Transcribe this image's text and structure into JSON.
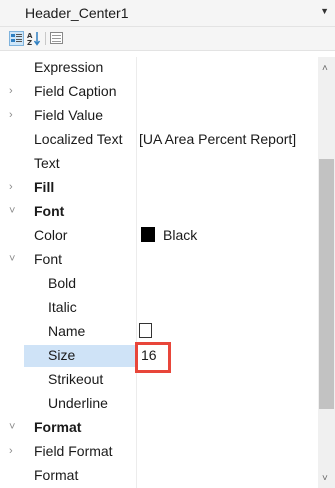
{
  "object_selector": {
    "selected": "Header_Center1"
  },
  "toolbar": {
    "categorized_icon": "categorized-icon",
    "alphabetical_label": "A Z",
    "property_pages_icon": "property-pages-icon"
  },
  "properties": [
    {
      "name": "Expression",
      "value": "",
      "expander": "",
      "category": false
    },
    {
      "name": "Field Caption",
      "value": "",
      "expander": "›",
      "category": false
    },
    {
      "name": "Field Value",
      "value": "",
      "expander": "›",
      "category": false
    },
    {
      "name": "Localized Text",
      "value": "[UA Area Percent Report]",
      "expander": "",
      "category": false
    },
    {
      "name": "Text",
      "value": "",
      "expander": "",
      "category": false
    },
    {
      "name": "Fill",
      "value": "",
      "expander": "›",
      "category": true
    },
    {
      "name": "Font",
      "value": "",
      "expander": "˅",
      "category": true
    },
    {
      "name": "Color",
      "value": "Black",
      "expander": "",
      "category": false,
      "color": "#000000"
    },
    {
      "name": "Font",
      "value": "",
      "expander": "˅",
      "category": false
    },
    {
      "name": "Bold",
      "value": "",
      "expander": "",
      "category": false
    },
    {
      "name": "Italic",
      "value": "",
      "expander": "",
      "category": false
    },
    {
      "name": "Name",
      "value": "",
      "expander": "",
      "category": false
    },
    {
      "name": "Size",
      "value": "16",
      "expander": "",
      "category": false,
      "selected": true
    },
    {
      "name": "Strikeout",
      "value": "",
      "expander": "",
      "category": false
    },
    {
      "name": "Underline",
      "value": "",
      "expander": "",
      "category": false
    },
    {
      "name": "Format",
      "value": "",
      "expander": "˅",
      "category": true
    },
    {
      "name": "Field Format",
      "value": "",
      "expander": "›",
      "category": false
    },
    {
      "name": "Format",
      "value": "",
      "expander": "",
      "category": false
    }
  ],
  "colors": {
    "selection": "#cfe3f7",
    "highlight_border": "#e8463a"
  }
}
